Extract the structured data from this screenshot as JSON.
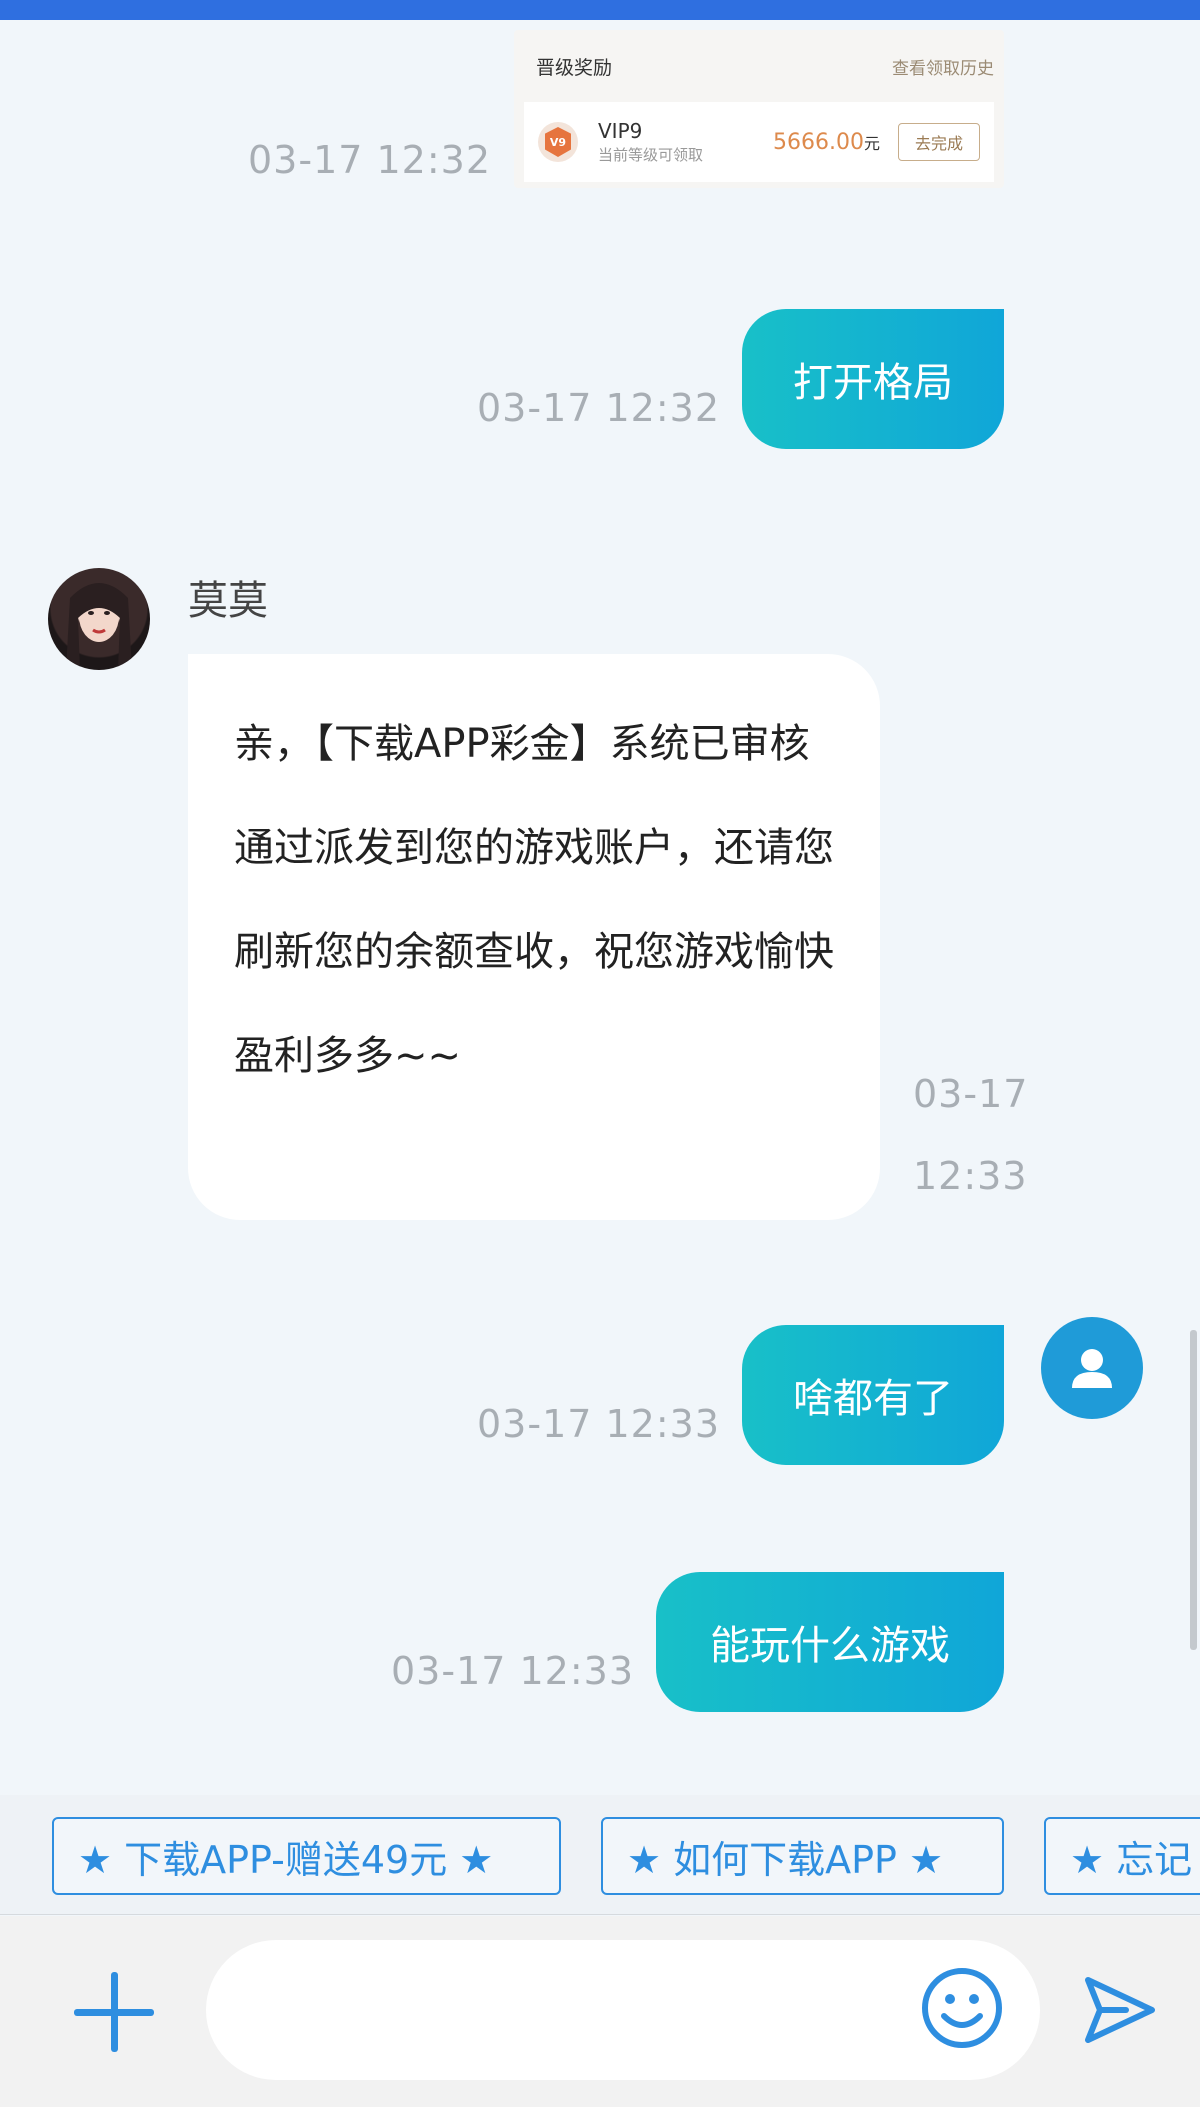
{
  "shared_card": {
    "title": "晋级奖励",
    "history_link": "查看领取历史",
    "badge": "V9",
    "vip_level": "VIP9",
    "vip_sub": "当前等级可领取",
    "amount": "5666.00",
    "amount_unit": "元",
    "action": "去完成"
  },
  "messages": [
    {
      "side": "out",
      "type": "image",
      "time": "03-17 12:32"
    },
    {
      "side": "out",
      "text": "打开格局",
      "time": "03-17 12:32"
    },
    {
      "side": "in",
      "sender": "莫莫",
      "text": "亲，【下载APP彩金】系统已审核通过派发到您的游戏账户，还请您刷新您的余额查收，祝您游戏愉快盈利多多~~",
      "time_line1": "03-17",
      "time_line2": "12:33"
    },
    {
      "side": "out",
      "text": "啥都有了",
      "time": "03-17 12:33"
    },
    {
      "side": "out",
      "text": "能玩什么游戏",
      "time": "03-17 12:33"
    }
  ],
  "quick_replies": [
    "★ 下载APP-赠送49元 ★",
    "★ 如何下载APP ★",
    "★ 忘记"
  ],
  "input": {
    "value": "",
    "placeholder": ""
  },
  "icons": {
    "add": "plus-icon",
    "emoji": "smiley-icon",
    "send": "send-icon",
    "user_avatar": "user-silhouette-icon",
    "vip_badge": "vip-badge-icon"
  },
  "colors": {
    "accent": "#2e8ee0",
    "bubble_gradient_start": "#18c0c8",
    "bubble_gradient_end": "#10a6d8",
    "top_bar": "#2f6fe0",
    "amount": "#dd8a4c"
  }
}
